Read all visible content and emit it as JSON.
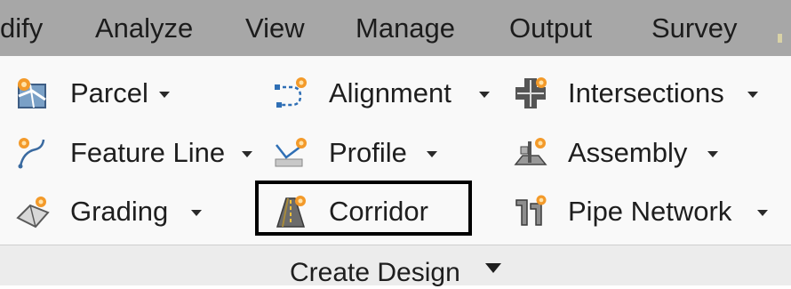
{
  "tabs": [
    {
      "label": "dify"
    },
    {
      "label": "Analyze"
    },
    {
      "label": "View"
    },
    {
      "label": "Manage"
    },
    {
      "label": "Output"
    },
    {
      "label": "Survey"
    }
  ],
  "panel": {
    "title": "Create Design",
    "items": [
      {
        "label": "Parcel",
        "icon": "parcel-icon",
        "dropdown": true
      },
      {
        "label": "Alignment",
        "icon": "alignment-icon",
        "dropdown": true
      },
      {
        "label": "Intersections",
        "icon": "intersections-icon",
        "dropdown": true
      },
      {
        "label": "Feature Line",
        "icon": "feature-line-icon",
        "dropdown": true
      },
      {
        "label": "Profile",
        "icon": "profile-icon",
        "dropdown": true
      },
      {
        "label": "Assembly",
        "icon": "assembly-icon",
        "dropdown": true
      },
      {
        "label": "Grading",
        "icon": "grading-icon",
        "dropdown": true
      },
      {
        "label": "Corridor",
        "icon": "corridor-icon",
        "dropdown": false,
        "highlighted": true
      },
      {
        "label": "Pipe Network",
        "icon": "pipe-network-icon",
        "dropdown": true
      }
    ]
  },
  "colors": {
    "tab_bar": "#a7a7a7",
    "panel_bg": "#f9f9f9",
    "footer_bg": "#ececec",
    "accent_orange": "#f39a2a",
    "highlight_border": "#000000"
  }
}
